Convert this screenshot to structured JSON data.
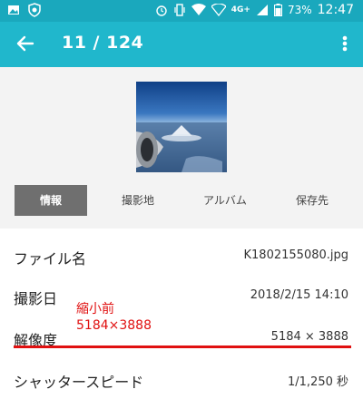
{
  "status_bar": {
    "icons": [
      "image-icon",
      "shield-icon",
      "alarm-icon",
      "vibrate-icon",
      "wifi-icon",
      "hotspot-icon",
      "signal-icon",
      "battery-icon"
    ],
    "network": "4G+",
    "battery": "73%",
    "time": "12:47"
  },
  "app_bar": {
    "title": "11 / 124",
    "color": "#20b7cc"
  },
  "tabs": [
    {
      "label": "情報",
      "active": true
    },
    {
      "label": "撮影地",
      "active": false
    },
    {
      "label": "アルバム",
      "active": false
    },
    {
      "label": "保存先",
      "active": false
    }
  ],
  "info": {
    "filename": {
      "label": "ファイル名",
      "value": "K1802155080.jpg"
    },
    "date": {
      "label": "撮影日",
      "value": "2018/2/15 14:10"
    },
    "resolution": {
      "label": "解像度",
      "value": "5184 × 3888"
    },
    "shutter": {
      "label": "シャッタースピード",
      "value": "1/1,250 秒"
    }
  },
  "annotation": {
    "line1": "縮小前",
    "line2": "5184×3888",
    "color": "#e01010"
  }
}
